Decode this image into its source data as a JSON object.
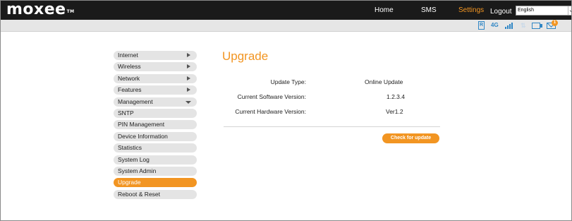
{
  "brand": {
    "logo": "moxee",
    "trademark": "TM"
  },
  "header": {
    "nav": {
      "home": "Home",
      "sms": "SMS",
      "settings": "Settings",
      "logout": "Logout"
    },
    "language": {
      "selected": "English"
    }
  },
  "status": {
    "roaming": "R",
    "network": "4G",
    "data_arrows": "⇅",
    "messages_unread": "1"
  },
  "sidebar": {
    "items": [
      {
        "label": "Internet"
      },
      {
        "label": "Wireless"
      },
      {
        "label": "Network"
      },
      {
        "label": "Features"
      },
      {
        "label": "Management"
      },
      {
        "label": "SNTP"
      },
      {
        "label": "PIN Management"
      },
      {
        "label": "Device Information"
      },
      {
        "label": "Statistics"
      },
      {
        "label": "System Log"
      },
      {
        "label": "System Admin"
      },
      {
        "label": "Upgrade"
      },
      {
        "label": "Reboot & Reset"
      }
    ],
    "active_index": 11
  },
  "main": {
    "title": "Upgrade",
    "update_type_label": "Update Type:",
    "update_type_value": "Online Update",
    "software_label": "Current Software Version:",
    "software_value": "1.2.3.4",
    "hardware_label": "Current Hardware Version:",
    "hardware_value": "Ver1.2",
    "check_button": "Check for update"
  },
  "colors": {
    "accent": "#f29522",
    "status_icon": "#2f86c5",
    "header_bg": "#1a1a1a"
  }
}
